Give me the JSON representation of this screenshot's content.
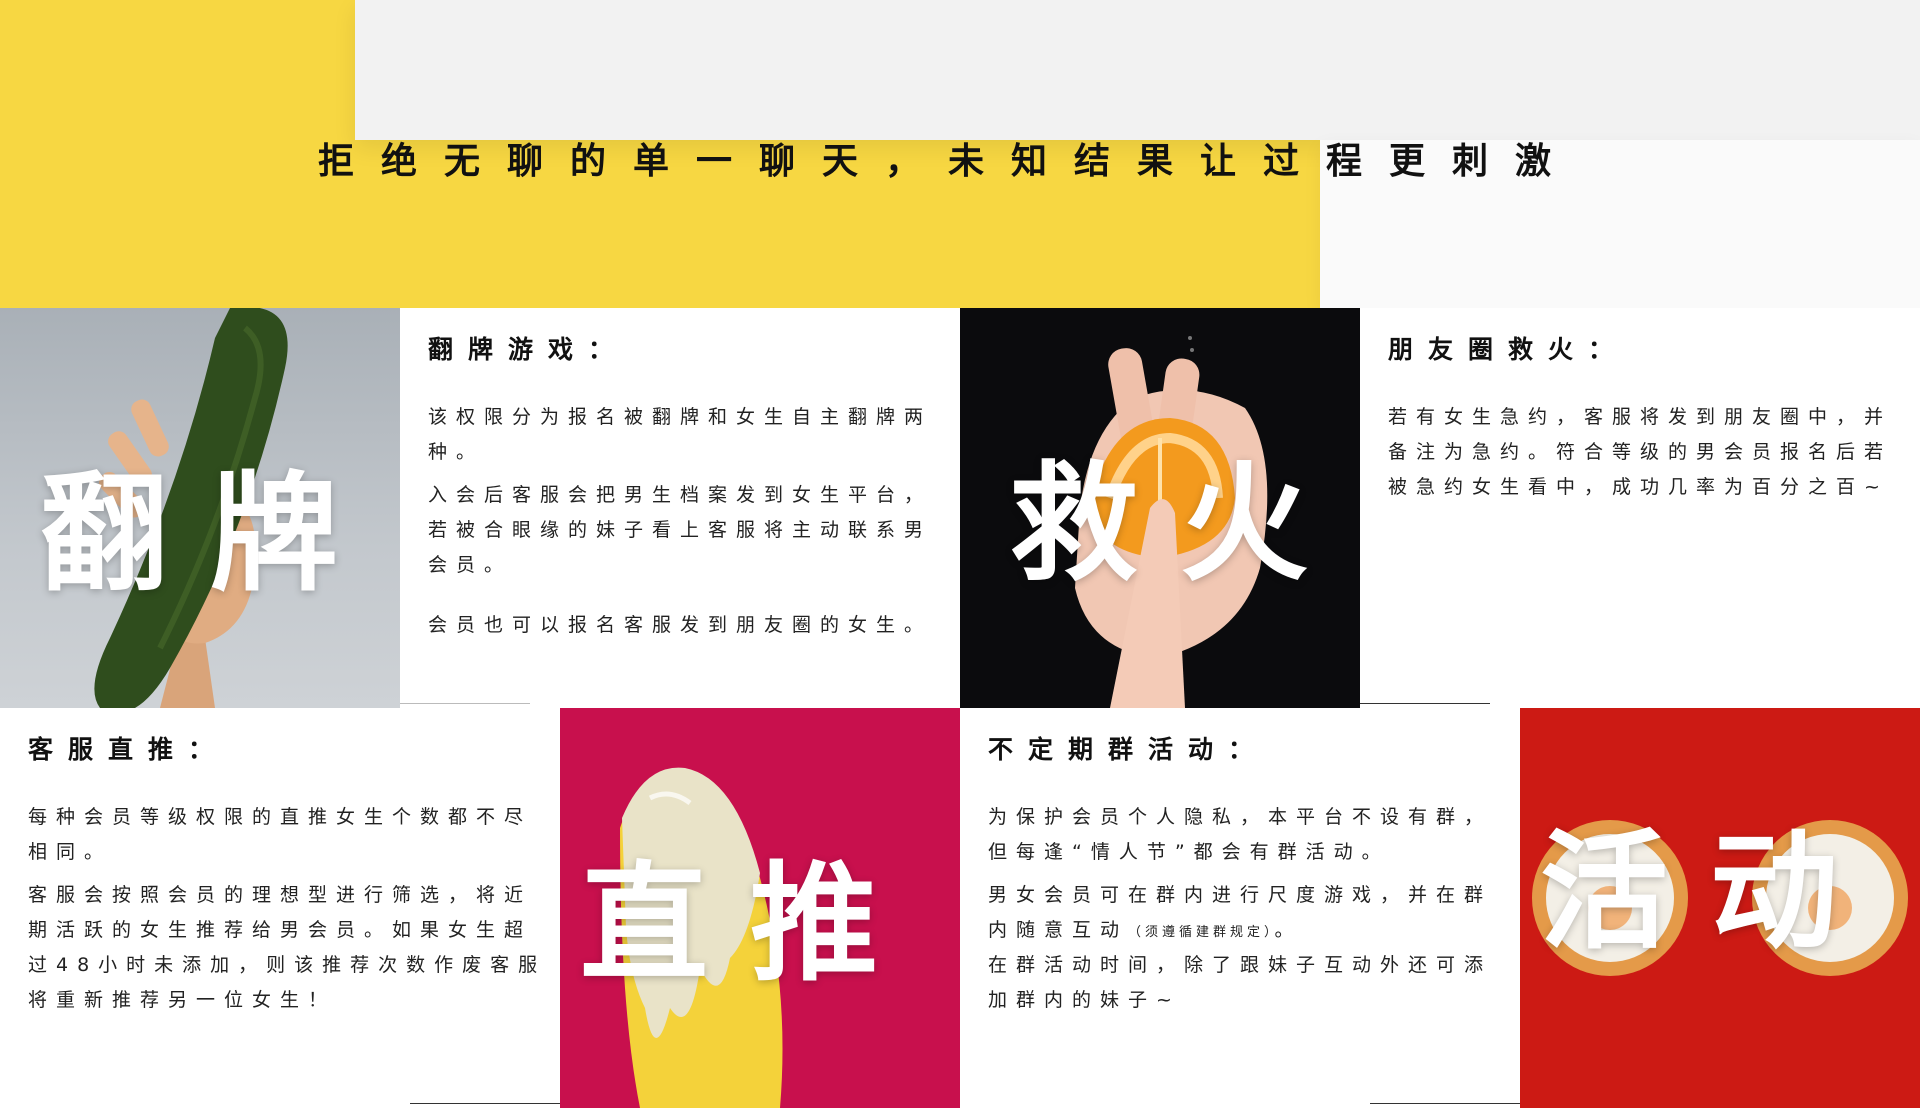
{
  "headline": "拒绝无聊的单一聊天，未知结果让过程更刺激",
  "sections": {
    "fanpai": {
      "big_label": "翻牌",
      "title": "翻牌游戏：",
      "paragraphs": [
        "该权限分为报名被翻牌和女生自主翻牌两种。",
        "入会后客服会把男生档案发到女生平台，若被合眼缘的妹子看上客服将主动联系男会员。",
        "会员也可以报名客服发到朋友圈的女生。"
      ]
    },
    "jiuhuo": {
      "big_label": "救火",
      "title": "朋友圈救火：",
      "paragraphs": [
        "若有女生急约，客服将发到朋友圈中，并备注为急约。符合等级的男会员报名后若被急约女生看中，成功几率为百分之百~"
      ]
    },
    "zhitui": {
      "big_label": "直推",
      "title": "客服直推：",
      "paragraphs": [
        "每种会员等级权限的直推女生个数都不尽相同。",
        "客服会按照会员的理想型进行筛选，将近期活跃的女生推荐给男会员。如果女生超过48小时未添加，则该推荐次数作废客服将重新推荐另一位女生！"
      ]
    },
    "huodong": {
      "big_label": "活动",
      "title": "不定期群活动：",
      "paragraph_1": "为保护会员个人隐私，本平台不设有群，但每逢“情人节”都会有群活动。",
      "paragraph_2_main": "男女会员可在群内进行尺度游戏，并在群内随意互动",
      "paragraph_2_note": "（须遵循建群规定）",
      "paragraph_2_end": "。",
      "paragraph_3": "在群活动时间，除了跟妹子互动外还可添加群内的妹子~"
    }
  },
  "colors": {
    "yellow": "#f7d742",
    "magenta": "#c8104d",
    "red": "#cc1a14",
    "dark": "#0b0b0d",
    "gray_photo": "#b9c0c6"
  }
}
